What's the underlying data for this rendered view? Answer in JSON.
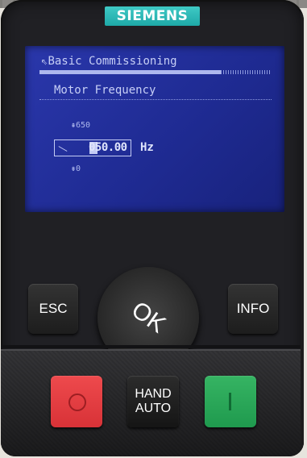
{
  "brand": {
    "logo_text": "SIEMENS",
    "color": "#25b5b3"
  },
  "screen": {
    "menu_title": "Basic Commissioning",
    "menu_icon": "up-arrow-icon",
    "menu_prefix": "⇖",
    "progress": 0.78,
    "parameter_title": "Motor Frequency",
    "max_text": "⇞650",
    "min_text": "⇟0",
    "value_text": "050.00",
    "unit_text": "Hz",
    "background_color": "#2231a0"
  },
  "buttons": {
    "esc_label": "ESC",
    "info_label": "INFO",
    "ok_label": "OK",
    "hand_line1": "HAND",
    "hand_line2": "AUTO",
    "off_color": "#e8413f",
    "on_color": "#2cab5c"
  }
}
